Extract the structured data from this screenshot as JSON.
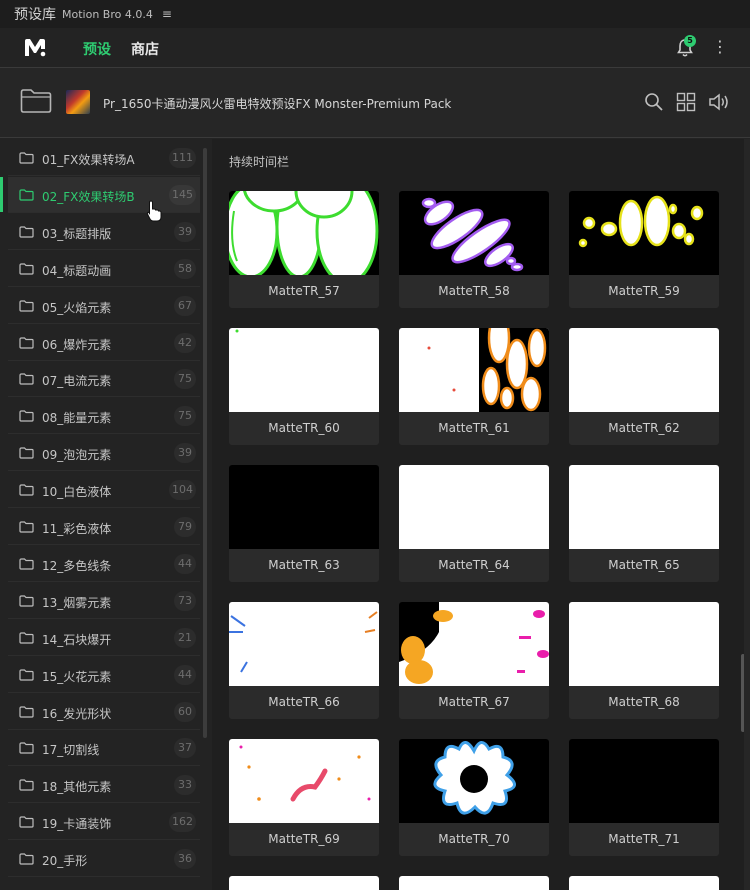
{
  "titlebar": {
    "title": "预设库",
    "app": "Motion Bro 4.0.4",
    "menu_glyph": "≡"
  },
  "nav": {
    "logo": "motion-bro-logo",
    "tabs": [
      {
        "label": "预设",
        "active": true
      },
      {
        "label": "商店",
        "active": false
      }
    ],
    "notification_count": "5",
    "more_glyph": "⋮"
  },
  "pack": {
    "title": "Pr_1650卡通动漫风火雷电特效预设FX Monster-Premium Pack",
    "icons": [
      "search-icon",
      "grid-view-icon",
      "sound-icon"
    ]
  },
  "sidebar": {
    "items": [
      {
        "label": "01_FX效果转场A",
        "count": "111"
      },
      {
        "label": "02_FX效果转场B",
        "count": "145",
        "active": true
      },
      {
        "label": "03_标题排版",
        "count": "39"
      },
      {
        "label": "04_标题动画",
        "count": "58"
      },
      {
        "label": "05_火焰元素",
        "count": "67"
      },
      {
        "label": "06_爆炸元素",
        "count": "42"
      },
      {
        "label": "07_电流元素",
        "count": "75"
      },
      {
        "label": "08_能量元素",
        "count": "75"
      },
      {
        "label": "09_泡泡元素",
        "count": "39"
      },
      {
        "label": "10_白色液体",
        "count": "104"
      },
      {
        "label": "11_彩色液体",
        "count": "79"
      },
      {
        "label": "12_多色线条",
        "count": "44"
      },
      {
        "label": "13_烟雾元素",
        "count": "73"
      },
      {
        "label": "14_石块爆开",
        "count": "21"
      },
      {
        "label": "15_火花元素",
        "count": "44"
      },
      {
        "label": "16_发光形状",
        "count": "60"
      },
      {
        "label": "17_切割线",
        "count": "37"
      },
      {
        "label": "18_其他元素",
        "count": "33"
      },
      {
        "label": "19_卡通装饰",
        "count": "162"
      },
      {
        "label": "20_手形",
        "count": "36"
      }
    ]
  },
  "content": {
    "section_title": "持续时间栏",
    "cards": [
      {
        "label": "MatteTR_57",
        "thumb": "green-ellipses-on-white"
      },
      {
        "label": "MatteTR_58",
        "thumb": "purple-diagonal-blobs-on-black"
      },
      {
        "label": "MatteTR_59",
        "thumb": "yellow-ellipses-on-black"
      },
      {
        "label": "MatteTR_60",
        "thumb": "mostly-white"
      },
      {
        "label": "MatteTR_61",
        "thumb": "orange-blobs-on-white"
      },
      {
        "label": "MatteTR_62",
        "thumb": "white"
      },
      {
        "label": "MatteTR_63",
        "thumb": "black"
      },
      {
        "label": "MatteTR_64",
        "thumb": "white"
      },
      {
        "label": "MatteTR_65",
        "thumb": "white"
      },
      {
        "label": "MatteTR_66",
        "thumb": "white-with-blue-orange-streaks"
      },
      {
        "label": "MatteTR_67",
        "thumb": "white-splash-yellow-pink"
      },
      {
        "label": "MatteTR_68",
        "thumb": "white"
      },
      {
        "label": "MatteTR_69",
        "thumb": "white-with-pink-squiggle"
      },
      {
        "label": "MatteTR_70",
        "thumb": "white-blue-splat-on-black"
      },
      {
        "label": "MatteTR_71",
        "thumb": "black"
      }
    ]
  },
  "colors": {
    "accent": "#2ecc71",
    "background": "#232323",
    "panel": "#1f1f1f",
    "card": "#2b2b2b"
  }
}
